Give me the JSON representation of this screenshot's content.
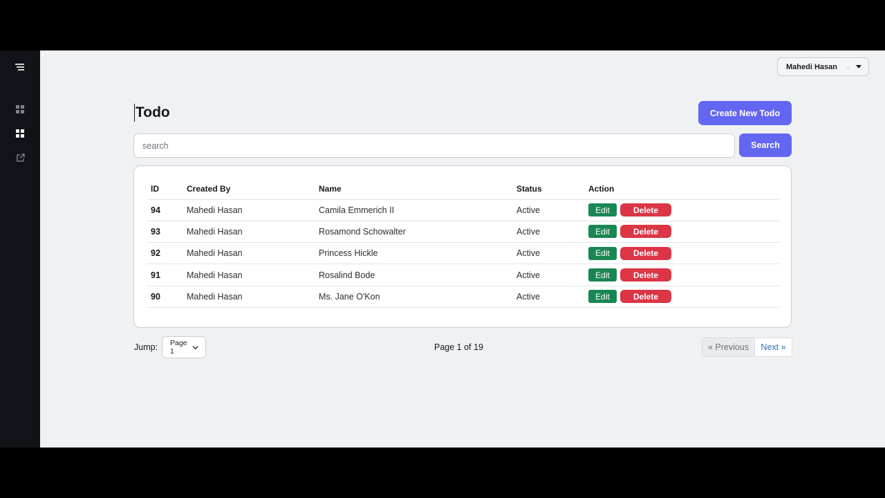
{
  "sidebar": {
    "items": [
      {
        "icon": "menu-icon"
      },
      {
        "icon": "dashboard-icon"
      },
      {
        "icon": "todo-icon"
      },
      {
        "icon": "external-link-icon"
      }
    ]
  },
  "header": {
    "user_name": "Mahedi Hasan",
    "separator": "⌄"
  },
  "page": {
    "title": "Todo",
    "create_label": "Create New Todo"
  },
  "search": {
    "placeholder": "search",
    "value": "",
    "button_label": "Search"
  },
  "table": {
    "columns": [
      "ID",
      "Created By",
      "Name",
      "Status",
      "Action"
    ],
    "rows": [
      {
        "id": "94",
        "created_by": "Mahedi Hasan",
        "name": "Camila Emmerich II",
        "status": "Active"
      },
      {
        "id": "93",
        "created_by": "Mahedi Hasan",
        "name": "Rosamond Schowalter",
        "status": "Active"
      },
      {
        "id": "92",
        "created_by": "Mahedi Hasan",
        "name": "Princess Hickle",
        "status": "Active"
      },
      {
        "id": "91",
        "created_by": "Mahedi Hasan",
        "name": "Rosalind Bode",
        "status": "Active"
      },
      {
        "id": "90",
        "created_by": "Mahedi Hasan",
        "name": "Ms. Jane O'Kon",
        "status": "Active"
      }
    ],
    "edit_label": "Edit",
    "delete_label": "Delete"
  },
  "pagination": {
    "jump_label": "Jump:",
    "jump_value": "Page 1",
    "page_info": "Page 1 of 19",
    "prev_label": "« Previous",
    "next_label": "Next »"
  },
  "colors": {
    "primary": "#6366f1",
    "edit": "#198754",
    "delete": "#dc3545",
    "sidebar_bg": "#111318",
    "page_bg": "#f0f1f3"
  }
}
